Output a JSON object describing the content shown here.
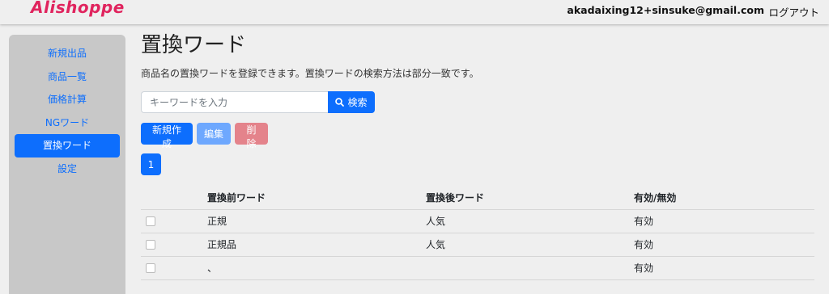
{
  "header": {
    "logo": "Alishoppe",
    "email": "akadaixing12+sinsuke@gmail.com",
    "logout": "ログアウト"
  },
  "sidebar": {
    "items": [
      {
        "label": "新規出品"
      },
      {
        "label": "商品一覧"
      },
      {
        "label": "価格計算"
      },
      {
        "label": "NGワード"
      },
      {
        "label": "置換ワード",
        "active": true
      },
      {
        "label": "設定"
      }
    ]
  },
  "main": {
    "title": "置換ワード",
    "description": "商品名の置換ワードを登録できます。置換ワードの検索方法は部分一致です。",
    "search": {
      "placeholder": "キーワードを入力",
      "button": "検索",
      "icon": "search-icon"
    },
    "buttons": {
      "create": "新規作成",
      "edit": "編集",
      "delete": "削除"
    },
    "pagination": {
      "current": "1"
    },
    "table": {
      "headers": [
        "置換前ワード",
        "置換後ワード",
        "有効/無効"
      ],
      "rows": [
        {
          "before": "正規",
          "after": "人気",
          "status": "有効"
        },
        {
          "before": "正規品",
          "after": "人気",
          "status": "有効"
        },
        {
          "before": "、",
          "after": "",
          "status": "有効"
        }
      ]
    }
  },
  "colors": {
    "primary": "#0d6efd",
    "logo": "#e0245e",
    "sidebar_bg": "#c8c8c8",
    "page_bg": "#efefef"
  }
}
